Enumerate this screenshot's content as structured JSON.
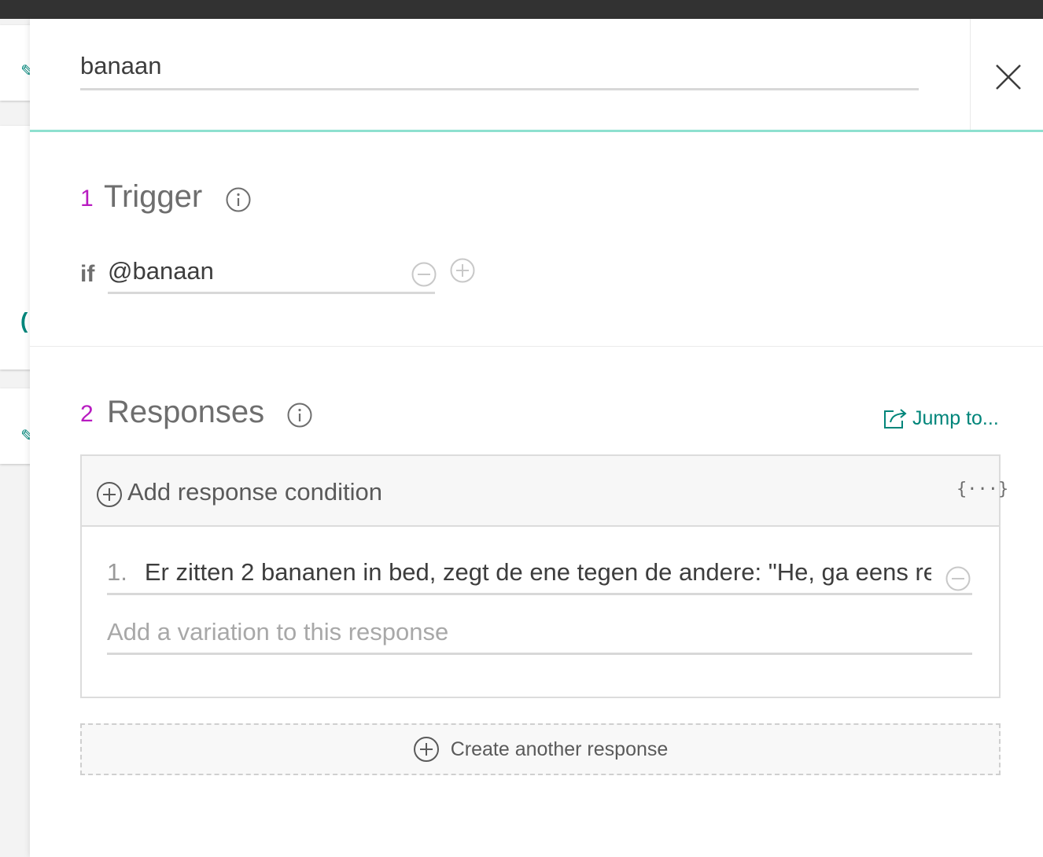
{
  "node": {
    "name": "banaan"
  },
  "trigger": {
    "number": "1",
    "title": "Trigger",
    "if_label": "if",
    "condition": "@banaan"
  },
  "responses": {
    "number": "2",
    "title": "Responses",
    "jump_to_label": "Jump to...",
    "add_condition_label": "Add response condition",
    "json_editor_label": "{···}",
    "variations": [
      {
        "index": "1.",
        "text": "Er zitten 2 bananen in bed, zegt de ene tegen de andere: \"He, ga eens re"
      }
    ],
    "add_variation_placeholder": "Add a variation to this response",
    "create_another_label": "Create another response"
  },
  "colors": {
    "accent_teal": "#00857a",
    "header_underline": "#8ee0cf",
    "section_number": "#b81bc1",
    "topbar": "#323232"
  }
}
